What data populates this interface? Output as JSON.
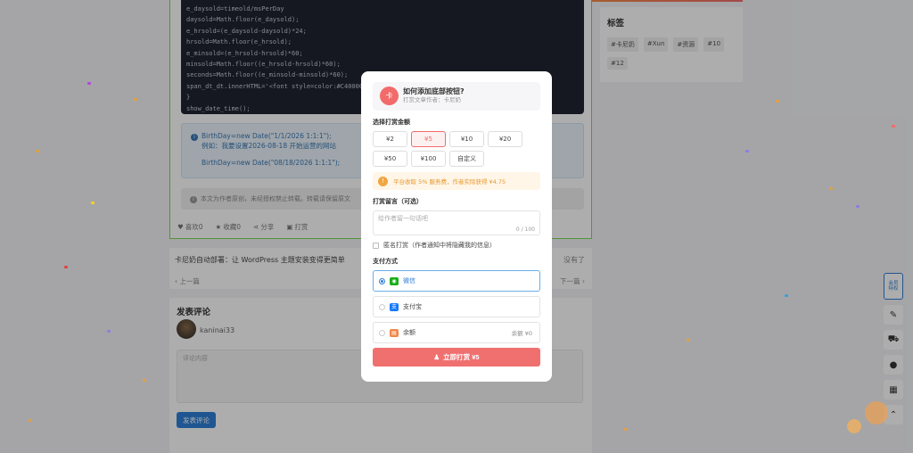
{
  "code_lines": [
    "e_daysold=timeold/msPerDay",
    "daysold=Math.floor(e_daysold);",
    "e_hrsold=(e_daysold-daysold)*24;",
    "hrsold=Math.floor(e_hrsold);",
    "e_minsold=(e_hrsold-hrsold)*60;",
    "minsold=Math.floor((e_hrsold-hrsold)*60);",
    "seconds=Math.floor((e_minsold-minsold)*60);",
    "span_dt_dt.innerHTML='<font style=color:#C40000>",
    "}",
    "show_date_time();"
  ],
  "note": {
    "line1": "BirthDay=new Date(\"1/1/2026 1:1:1\");",
    "line2": "例如：我要设置2026-08-18 开始运营的网站",
    "line3": "BirthDay=new Date(\"08/18/2026 1:1:1\");"
  },
  "copyright_text": "本文为作者原创，未经授权禁止转载。转载请保留原文",
  "actions": {
    "like": "喜欢0",
    "collect": "收藏0",
    "share": "分享",
    "reward": "打赏"
  },
  "nav": {
    "next_title": "卡尼奶自动部署：让 WordPress 主题安装变得更简单",
    "right_text": "没有了",
    "prev": "上一篇",
    "next": "下一篇"
  },
  "comment": {
    "title": "发表评论",
    "username": "kaninai33",
    "placeholder": "评论内容",
    "submit": "发表评论"
  },
  "tags": {
    "title": "标签",
    "items": [
      "#卡尼奶",
      "#Xun",
      "#资源",
      "#10",
      "#12"
    ]
  },
  "side_tools": {
    "member_line1": "会员",
    "member_line2": "特权"
  },
  "modal": {
    "badge": "卡",
    "title": "如何添加底部按钮?",
    "author": "打赏文章作者：卡尼奶",
    "amount_label": "选择打赏金额",
    "amounts": [
      "¥2",
      "¥5",
      "¥10",
      "¥20",
      "¥50",
      "¥100",
      "自定义"
    ],
    "fee_note": "平台收取 5% 服务费，作者实际获得 ¥4.75",
    "message_label": "打赏留言（可选）",
    "message_placeholder": "给作者留一句话吧",
    "message_count": "0 / 100",
    "anonymous": "匿名打赏（作者通知中将隐藏我的信息）",
    "payment_label": "支付方式",
    "pay_wechat": "微信",
    "pay_alipay": "支付宝",
    "pay_balance": "余额",
    "balance_amount": "余额 ¥0",
    "pay_button": "立即打赏 ¥5"
  },
  "colors": {
    "accent": "#f07070",
    "selected_pay": "#2f7fd6",
    "warning": "#e8962b"
  }
}
